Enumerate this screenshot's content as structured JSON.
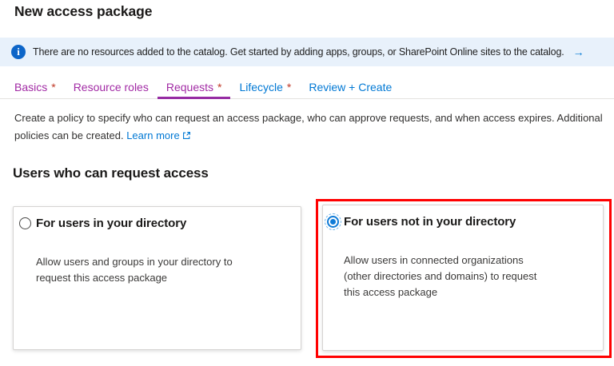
{
  "page": {
    "title": "New access package"
  },
  "banner": {
    "icon_glyph": "i",
    "message": "There are no resources added to the catalog. Get started by adding apps, groups, or SharePoint Online sites to the catalog.",
    "arrow": "→",
    "colors": {
      "background": "#e8f1fb",
      "icon": "#0d65c8",
      "arrow": "#0078d4"
    }
  },
  "tabs": {
    "items": [
      {
        "label": "Basics",
        "required_mark": "*",
        "state": "visited"
      },
      {
        "label": "Resource roles",
        "required_mark": "",
        "state": "visited"
      },
      {
        "label": "Requests",
        "required_mark": "*",
        "state": "active"
      },
      {
        "label": "Lifecycle",
        "required_mark": "*",
        "state": "unvisited"
      },
      {
        "label": "Review + Create",
        "required_mark": "",
        "state": "unvisited"
      }
    ],
    "colors": {
      "visited": "#a22ba5",
      "active_underline": "#962ca3",
      "unvisited": "#0078d4",
      "required_asterisk": "#c13a28"
    }
  },
  "description": {
    "line1": "Create a policy to specify who can request an access package, who can approve requests, and when access expires. Additional",
    "line2_prefix": "policies can be created. ",
    "link_label": "Learn more"
  },
  "section": {
    "heading": "Users who can request access"
  },
  "options": [
    {
      "title": "For users in your directory",
      "description_lines": [
        "Allow users and groups in your directory to",
        "request this access package"
      ],
      "selected": false
    },
    {
      "title": "For users not in your directory",
      "description_lines": [
        "Allow users in connected organizations",
        "(other directories and domains) to request",
        "this access package"
      ],
      "selected": true,
      "highlight": "red annotation box"
    }
  ]
}
